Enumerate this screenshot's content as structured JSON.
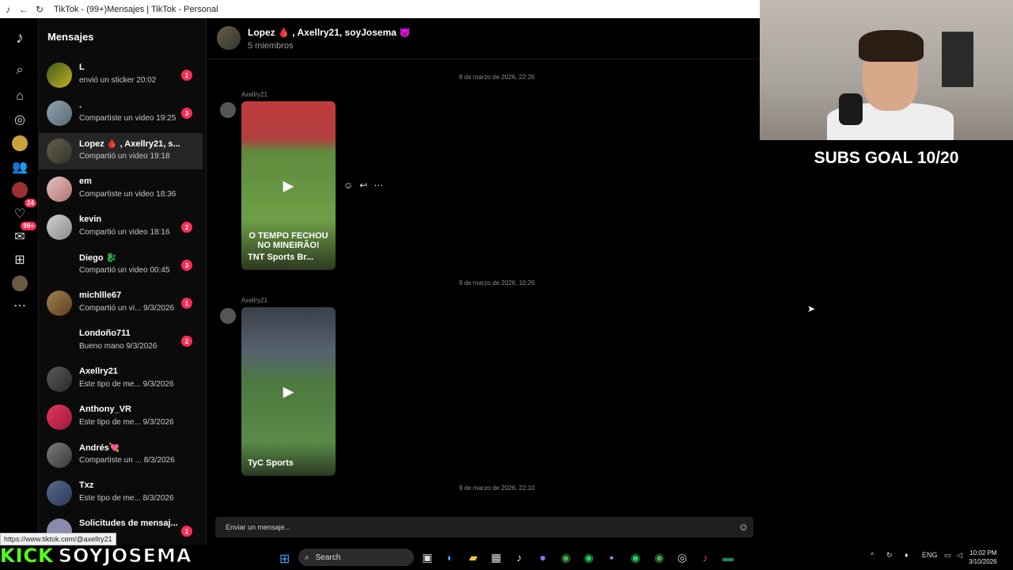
{
  "window": {
    "title": "TikTok - (99+)Mensajes | TikTok - Personal"
  },
  "rail": {
    "badge_notifications": "24",
    "badge_messages": "99+"
  },
  "inbox": {
    "heading": "Mensajes",
    "conversations": [
      {
        "name": "L",
        "preview": "envió un sticker 20:02",
        "badge": "1"
      },
      {
        "name": ".",
        "preview": "Compartiste un video 19:25",
        "badge": "3"
      },
      {
        "name": "Lopez 🩸 , Axellry21, s...",
        "preview": "Compartió un video 19:18",
        "badge": ""
      },
      {
        "name": "em",
        "preview": "Compartiste un video 18:36",
        "badge": ""
      },
      {
        "name": "kevin",
        "preview": "Compartió un video 18:16",
        "badge": "2"
      },
      {
        "name": "Diego 🐉",
        "preview": "Compartió un video 00:45",
        "badge": "3"
      },
      {
        "name": "michllle67",
        "preview": "Compartió un vi... 9/3/2026",
        "badge": "1"
      },
      {
        "name": "Londoño711",
        "preview": "Bueno mano 9/3/2026",
        "badge": "2"
      },
      {
        "name": "Axellry21",
        "preview": "Este tipo de me... 9/3/2026",
        "badge": ""
      },
      {
        "name": "Anthony_VR",
        "preview": "Este tipo de me... 9/3/2026",
        "badge": ""
      },
      {
        "name": "Andrés💘",
        "preview": "Compartiste un ... 8/3/2026",
        "badge": ""
      },
      {
        "name": "Txz",
        "preview": "Este tipo de me... 8/3/2026",
        "badge": ""
      },
      {
        "name": "Solicitudes de mensaj...",
        "preview": "",
        "badge": "1"
      }
    ]
  },
  "chat": {
    "group_name": "Lopez 🩸 , Axellry21, soyJosema 👿",
    "members": "5 miembros",
    "timestamp1": "8 de marzo de 2026, 22:26",
    "sender1": "Axellry21",
    "video1_headline": "O TEMPO FECHOU NO MINEIRÃO!",
    "video1_caption": "TNT Sports Br...",
    "timestamp2": "9 de marzo de 2026, 10:26",
    "sender2": "Axellry21",
    "video2_caption": "TyC Sports",
    "timestamp3": "9 de marzo de 2026, 22:10",
    "composer_placeholder": "Enviar un mensaje..."
  },
  "overlay": {
    "subs_goal": "SUBS GOAL 10/20",
    "status_url": "https://www.tiktok.com/@axellry21",
    "kick_left": "KICK",
    "kick_right": "SOYJOSEMA"
  },
  "taskbar": {
    "search_label": "Search",
    "lang": "ENG",
    "time": "10:02 PM",
    "date": "3/10/2026"
  },
  "colors": {
    "accent": "#fe2c55",
    "kick_green": "#53fc18"
  }
}
